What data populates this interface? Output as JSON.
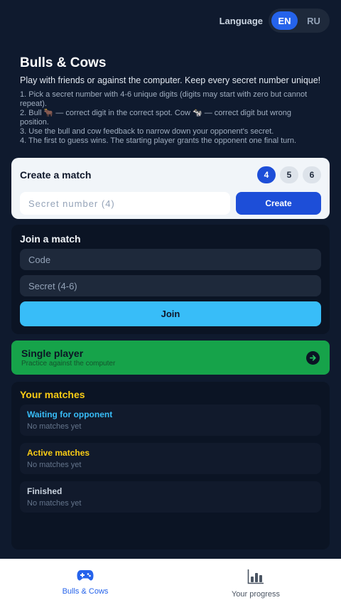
{
  "language": {
    "label": "Language",
    "options": [
      "EN",
      "RU"
    ],
    "selected": "EN"
  },
  "intro": {
    "title": "Bulls & Cows",
    "subtitle": "Play with friends or against the computer. Keep every secret number unique!",
    "rules": [
      "1. Pick a secret number with 4-6 unique digits (digits may start with zero but cannot repeat).",
      "2. Bull 🐂 — correct digit in the correct spot. Cow 🐄 — correct digit but wrong position.",
      "3. Use the bull and cow feedback to narrow down your opponent's secret.",
      "4. The first to guess wins. The starting player grants the opponent one final turn."
    ]
  },
  "create": {
    "title": "Create a match",
    "digit_options": [
      "4",
      "5",
      "6"
    ],
    "selected_digits": "4",
    "secret_placeholder": "Secret number (4)",
    "button": "Create"
  },
  "join": {
    "title": "Join a match",
    "code_placeholder": "Code",
    "secret_placeholder": "Secret (4-6)",
    "button": "Join"
  },
  "single": {
    "title": "Single player",
    "subtitle": "Practice against the computer",
    "icon": "arrow-right-icon"
  },
  "matches": {
    "title": "Your matches",
    "groups": [
      {
        "title": "Waiting for opponent",
        "empty": "No matches yet",
        "color": "#38bdf8"
      },
      {
        "title": "Active matches",
        "empty": "No matches yet",
        "color": "#facc15"
      },
      {
        "title": "Finished",
        "empty": "No matches yet",
        "color": "#cbd5e1"
      }
    ]
  },
  "nav": {
    "items": [
      {
        "label": "Bulls & Cows",
        "icon": "gamepad-icon",
        "active": true
      },
      {
        "label": "Your progress",
        "icon": "bar-chart-icon",
        "active": false
      }
    ]
  },
  "colors": {
    "background": "#0f1a2e",
    "accent": "#1d4ed8",
    "join": "#38bdf8",
    "single": "#16a34a",
    "matches_title": "#facc15"
  }
}
